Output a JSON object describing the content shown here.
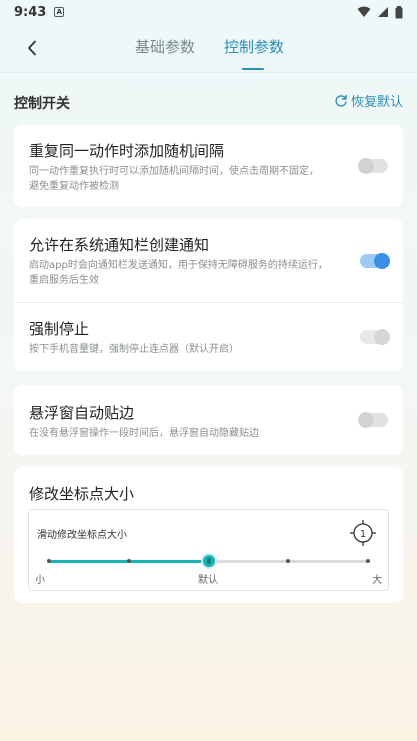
{
  "status_bar": {
    "time": "9:43",
    "notification_icon": "a-icon"
  },
  "header": {
    "back_icon": "chevron-left-icon",
    "tabs": [
      {
        "label": "基础参数",
        "active": false
      },
      {
        "label": "控制参数",
        "active": true
      }
    ]
  },
  "section": {
    "title": "控制开关",
    "reset_label": "恢复默认",
    "reset_icon": "refresh-icon"
  },
  "settings": [
    {
      "title": "重复同一动作时添加随机间隔",
      "desc_line1": "同一动作重复执行时可以添加随机间隔时间，使点击周期不固定，",
      "desc_line2": "避免重复动作被检测",
      "enabled": false
    },
    {
      "title": "允许在系统通知栏创建通知",
      "desc_line1": "启动app时会向通知栏发送通知，用于保持无障碍服务的持续运行，",
      "desc_line2": "重启服务后生效",
      "enabled": true
    },
    {
      "title": "强制停止",
      "desc_line1": "按下手机音量键，强制停止连点器（默认开启）",
      "enabled": true,
      "disabled": true
    },
    {
      "title": "悬浮窗自动贴边",
      "desc_line1": "在没有悬浮窗操作一段时间后，悬浮窗自动隐藏贴边",
      "enabled": false
    }
  ],
  "marker_size": {
    "title": "修改坐标点大小",
    "slider_label": "滑动修改坐标点大小",
    "preview_number": "1",
    "min_label": "小",
    "default_label": "默认",
    "max_label": "大",
    "steps": 5,
    "value_index": 2,
    "accent_color": "#1ab3b3"
  },
  "colors": {
    "accent": "#2a8fb5",
    "toggle_on": "#3a8ee6"
  }
}
